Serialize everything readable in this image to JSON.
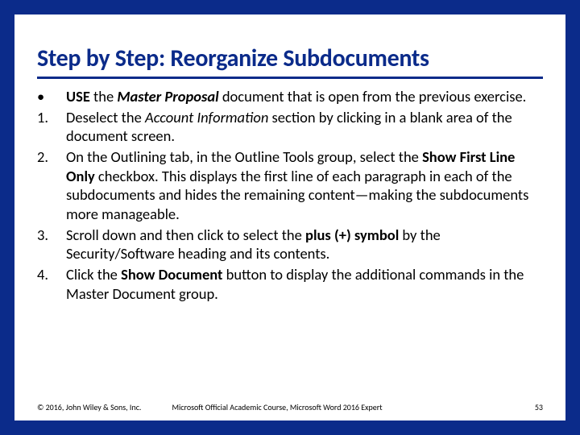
{
  "title": "Step by Step: Reorganize Subdocuments",
  "steps": [
    {
      "marker": "•",
      "html": "<b>USE</b> the <b><i>Master Proposal</i></b> document that is open from the previous exercise."
    },
    {
      "marker": "1.",
      "html": "Deselect the <i>Account Information</i> section by clicking in a blank area of the document screen."
    },
    {
      "marker": "2.",
      "html": "On the Outlining tab, in the Outline Tools group, select the <b>Show First Line Only</b> checkbox. This displays the first line of each paragraph in each of the subdocuments and hides the remaining content—making the subdocuments more manageable."
    },
    {
      "marker": "3.",
      "html": "Scroll down and then click to select the <b>plus (+) symbol</b> by the Security/Software heading and its contents."
    },
    {
      "marker": "4.",
      "html": "Click the <b>Show Document</b> button to display the additional commands in the Master Document group."
    }
  ],
  "footer": {
    "copyright": "© 2016, John Wiley & Sons, Inc.",
    "course": "Microsoft Official Academic Course, Microsoft Word 2016 Expert",
    "page": "53"
  }
}
